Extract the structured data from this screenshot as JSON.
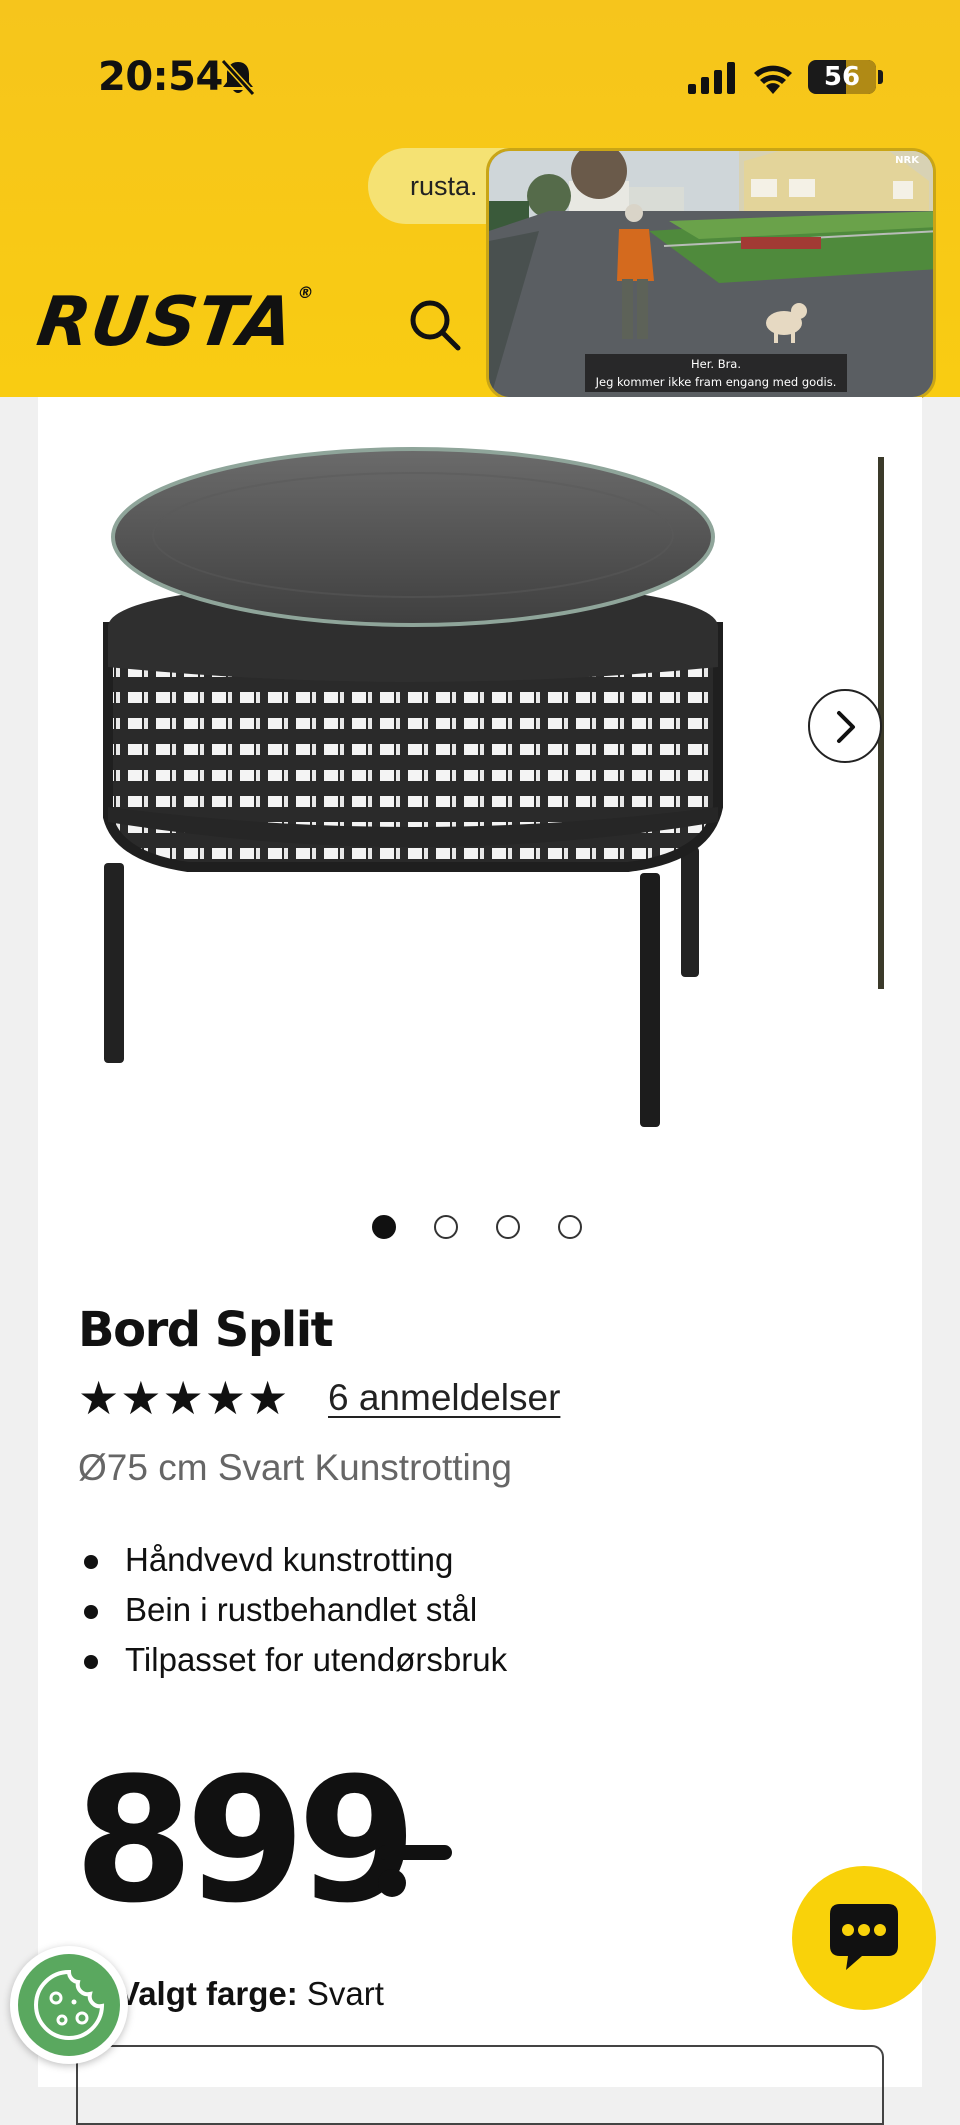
{
  "status_bar": {
    "time": "20:54",
    "battery": "56",
    "battery_level": 0.56
  },
  "browser": {
    "url_text": "rusta."
  },
  "header": {
    "logo_text": "RUSTA",
    "logo_mark": "®"
  },
  "video_overlay": {
    "corner_tag": "NRK",
    "subtitle_line1": "Her. Bra.",
    "subtitle_line2": "Jeg kommer ikke fram engang med godis."
  },
  "gallery": {
    "image_count": 4,
    "active_index": 0
  },
  "product": {
    "title": "Bord Split",
    "stars": "★★★★★",
    "rating": 5,
    "reviews_link": "6 anmeldelser",
    "subtitle": "Ø75 cm Svart Kunstrotting",
    "features": [
      "Håndvevd kunstrotting",
      "Bein i rustbehandlet stål",
      "Tilpasset for utendørsbruk"
    ],
    "price": "899",
    "color_label": "Valgt farge:",
    "color_value": "Svart"
  },
  "colors": {
    "brand_yellow": "#f9cc12",
    "text": "#111111",
    "cookie_green": "#5aa85f"
  },
  "icons": {
    "mute": "bell-slash-icon",
    "search": "search-icon",
    "next": "chevron-right-icon",
    "chat": "chat-bubble-icon",
    "cookie": "cookie-icon"
  }
}
